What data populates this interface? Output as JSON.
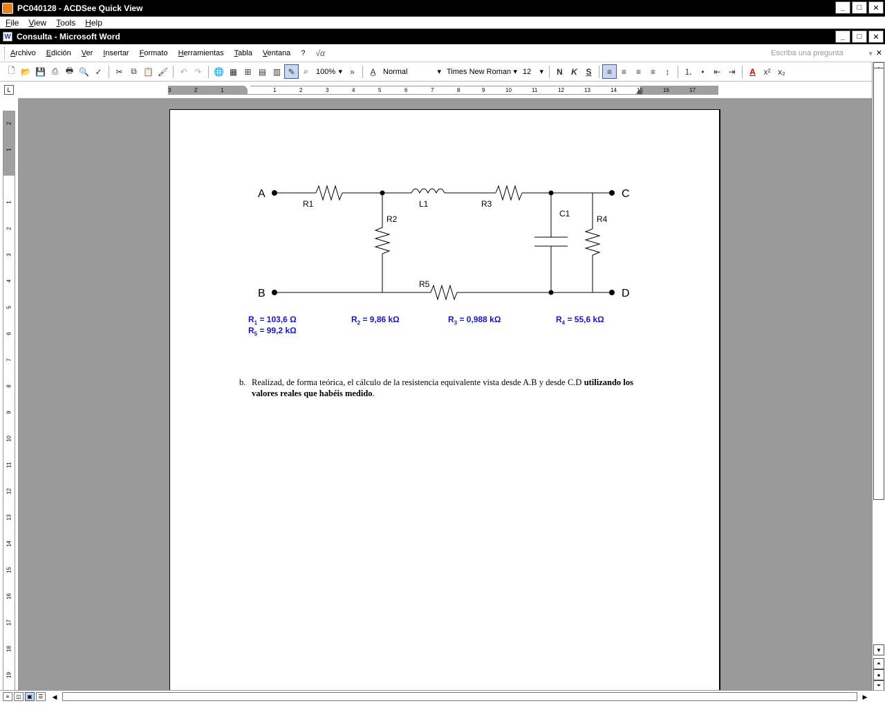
{
  "outer_window": {
    "title": "PC040128 - ACDSee Quick View",
    "menu": [
      "File",
      "View",
      "Tools",
      "Help"
    ]
  },
  "word_window": {
    "title": "Consulta - Microsoft Word",
    "menu": [
      "Archivo",
      "Edición",
      "Ver",
      "Insertar",
      "Formato",
      "Herramientas",
      "Tabla",
      "Ventana",
      "?"
    ],
    "ask_placeholder": "Escriba una pregunta"
  },
  "toolbar": {
    "zoom": "100%",
    "style": "Normal",
    "font": "Times New Roman",
    "size": "12",
    "bold": "N",
    "italic": "K",
    "underline": "S"
  },
  "ruler": {
    "h_numbers": [
      "3",
      "2",
      "1",
      "1",
      "2",
      "3",
      "4",
      "5",
      "6",
      "7",
      "8",
      "9",
      "10",
      "11",
      "12",
      "13",
      "14",
      "15",
      "16",
      "17"
    ],
    "v_numbers": [
      "2",
      "1",
      "1",
      "2",
      "3",
      "4",
      "5",
      "6",
      "7",
      "8",
      "9",
      "10",
      "11",
      "12",
      "13",
      "14",
      "15",
      "16",
      "17",
      "18",
      "19"
    ]
  },
  "circuit": {
    "nodes": [
      "A",
      "B",
      "C",
      "D"
    ],
    "components": [
      "R1",
      "L1",
      "R3",
      "R2",
      "C1",
      "R4",
      "R5"
    ]
  },
  "values": {
    "r1": "= 103,6 Ω",
    "r2": "= 9,86 kΩ",
    "r3": "= 0,988 kΩ",
    "r4": "= 55,6 kΩ",
    "r5": "= 99,2 kΩ",
    "r1_sub": "1",
    "r2_sub": "2",
    "r3_sub": "3",
    "r4_sub": "4",
    "r5_sub": "5",
    "r_letter": "R"
  },
  "paragraph": {
    "marker": "b.",
    "text": "Realizad, de forma teórica, el cálculo de la resistencia equivalente vista desde A.B y desde C.D",
    "bold_text": "utilizando los valores reales que habéis medido",
    "end": "."
  }
}
